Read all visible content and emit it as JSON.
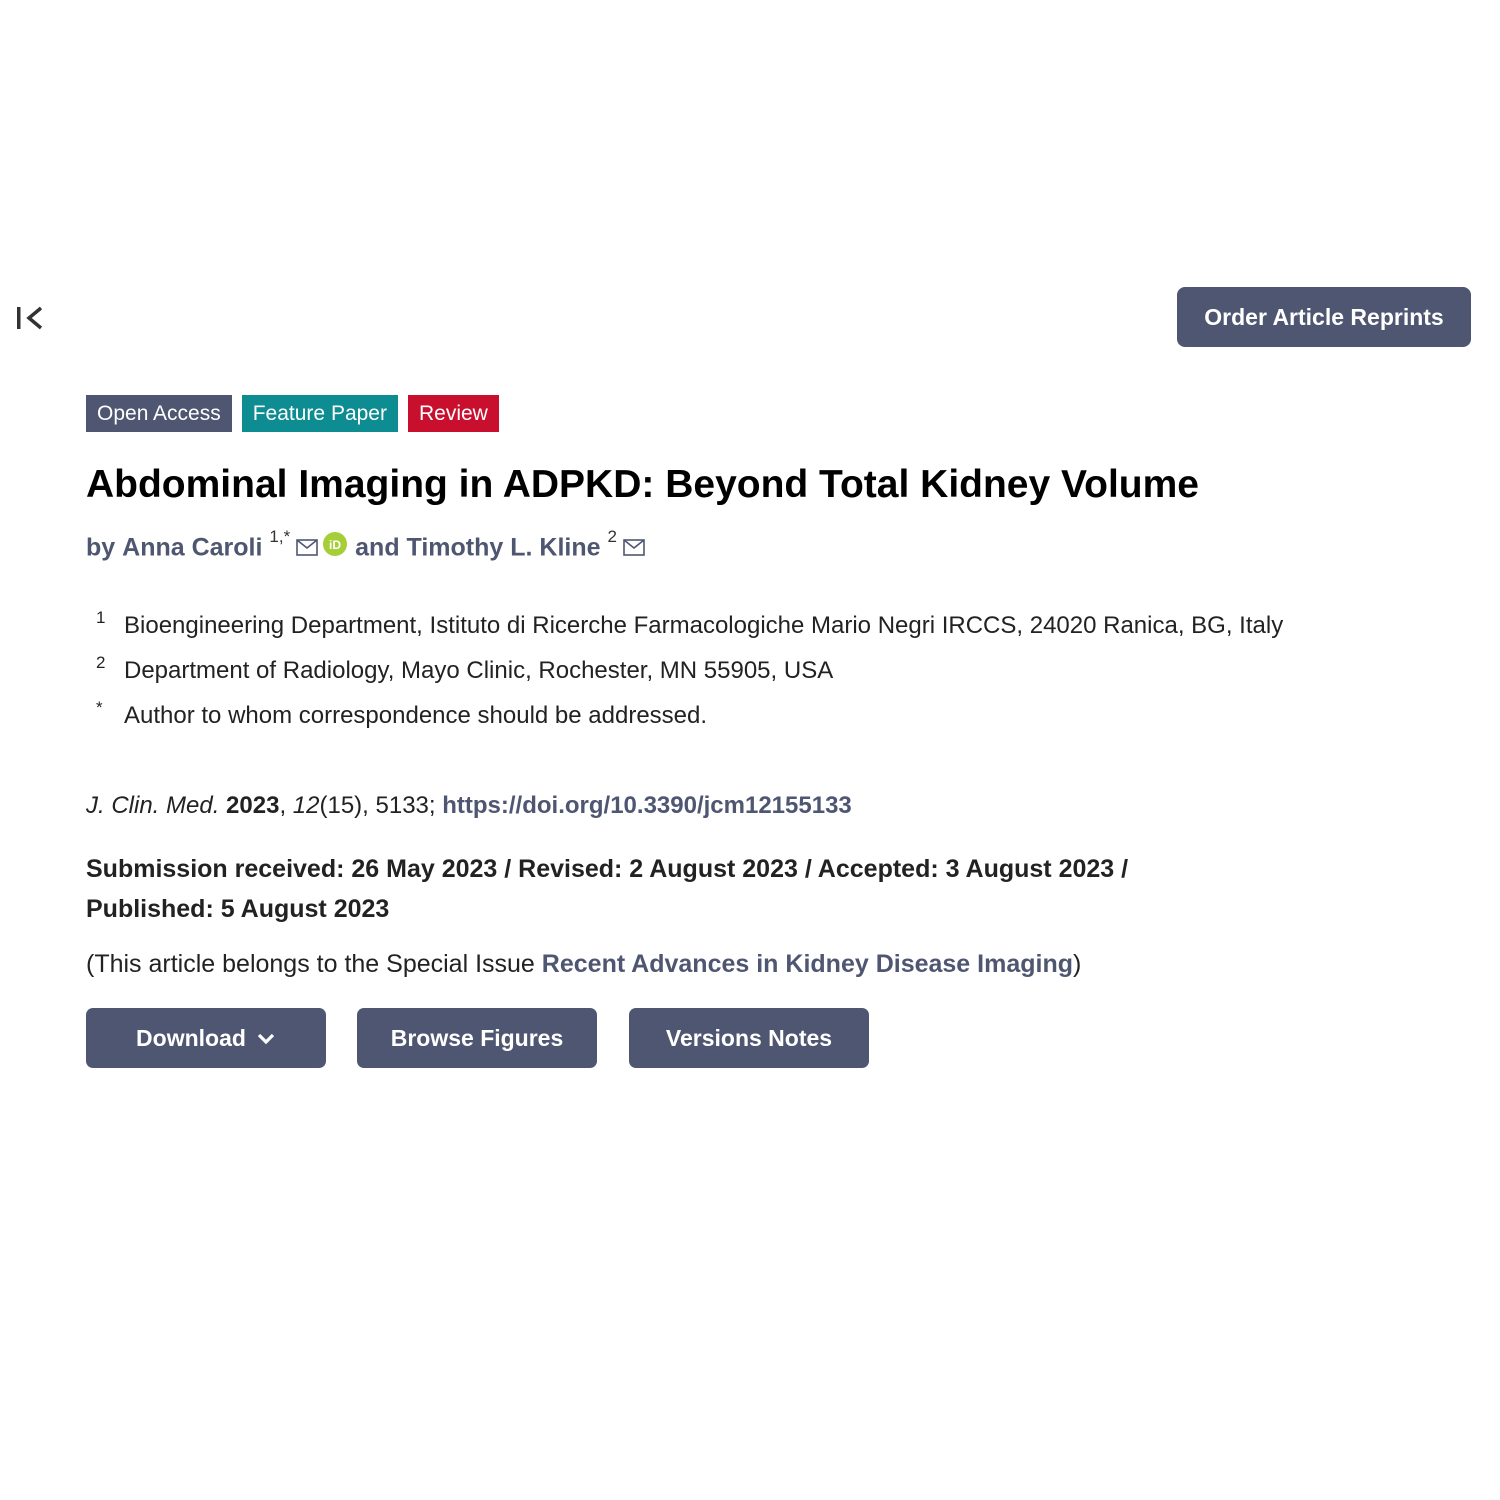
{
  "header": {
    "collapse_icon": "collapse-left-icon",
    "reprints_label": "Order Article Reprints"
  },
  "badges": {
    "open_access": "Open Access",
    "feature_paper": "Feature Paper",
    "review": "Review"
  },
  "article": {
    "title": "Abdominal Imaging in ADPKD: Beyond Total Kidney Volume",
    "by": "by",
    "and": "and",
    "authors": [
      {
        "name": "Anna Caroli",
        "sup": "1,*"
      },
      {
        "name": "Timothy L. Kline",
        "sup": "2"
      }
    ]
  },
  "affiliations": [
    {
      "num": "1",
      "text": "Bioengineering Department, Istituto di Ricerche Farmacologiche Mario Negri IRCCS, 24020 Ranica, BG, Italy"
    },
    {
      "num": "2",
      "text": "Department of Radiology, Mayo Clinic, Rochester, MN 55905, USA"
    },
    {
      "num": "*",
      "text": "Author to whom correspondence should be addressed."
    }
  ],
  "citation": {
    "journal": "J. Clin. Med.",
    "year": "2023",
    "volume": "12",
    "issue_pages": "(15), 5133;",
    "doi": "https://doi.org/10.3390/jcm12155133"
  },
  "dates": {
    "text": "Submission received: 26 May 2023 / Revised: 2 August 2023 / Accepted: 3 August 2023 / Published: 5 August 2023"
  },
  "special_issue": {
    "prefix": "(This article belongs to the Special Issue ",
    "link": "Recent Advances in Kidney Disease Imaging",
    "suffix": ")"
  },
  "actions": {
    "download": "Download",
    "browse_figures": "Browse Figures",
    "versions_notes": "Versions Notes"
  },
  "colors": {
    "primary": "#4f5671",
    "feature": "#0d8c92",
    "review": "#c8102e",
    "orcid": "#a6ce39"
  }
}
